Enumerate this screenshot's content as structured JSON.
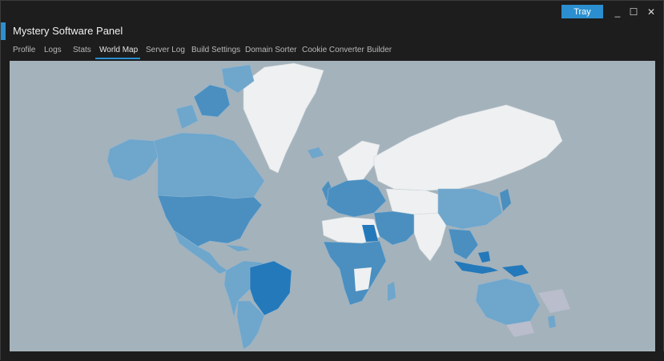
{
  "window": {
    "title": "Mystery Software Panel",
    "tray_label": "Tray",
    "controls": {
      "minimize": "_",
      "maximize": "☐",
      "close": "✕"
    }
  },
  "tabs": [
    {
      "label": "Profile",
      "active": false
    },
    {
      "label": "Logs",
      "active": false
    },
    {
      "label": "Stats",
      "active": false
    },
    {
      "label": "World Map",
      "active": true
    },
    {
      "label": "Server Log",
      "active": false
    },
    {
      "label": "Build Settings",
      "active": false
    },
    {
      "label": "Domain Sorter",
      "active": false
    },
    {
      "label": "Cookie Converter",
      "active": false
    },
    {
      "label": "Builder",
      "active": false
    }
  ],
  "map": {
    "ocean_color": "#a4b2bb",
    "colors": {
      "none": "#eef0f1",
      "low": "#6ea6cc",
      "medium": "#4a8fc0",
      "high": "#2479bb",
      "unknown": "#b9bdcc"
    }
  }
}
